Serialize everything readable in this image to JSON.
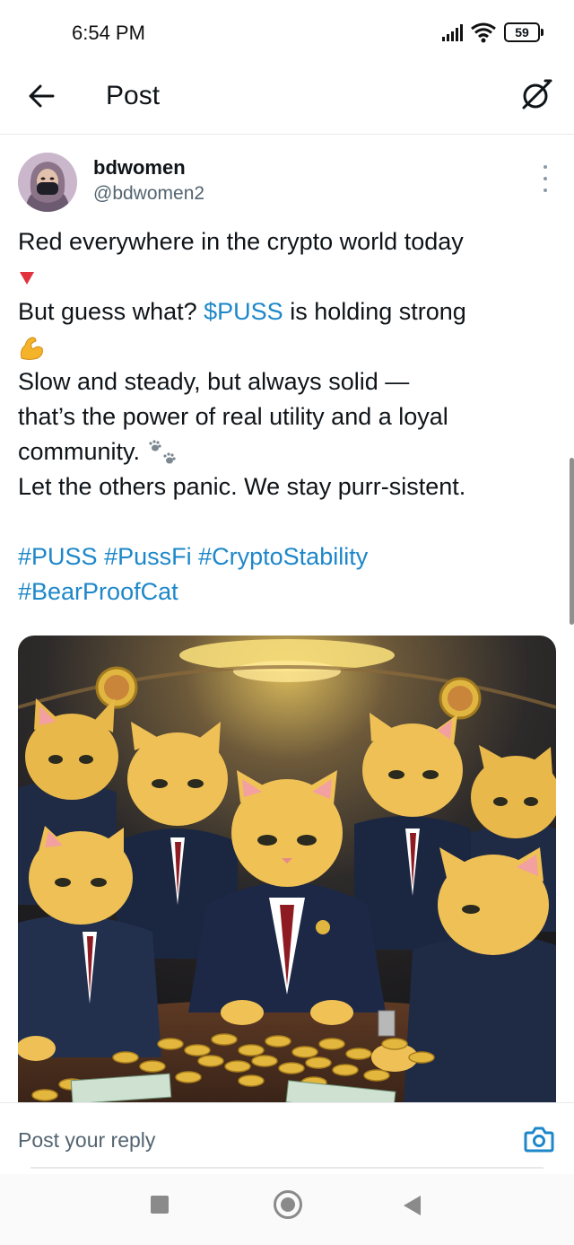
{
  "status_bar": {
    "time": "6:54 PM",
    "battery_level": "59",
    "icons": [
      "signal-icon",
      "wifi-icon",
      "battery-icon"
    ]
  },
  "header": {
    "title": "Post",
    "back_icon": "arrow-left-icon",
    "right_icon": "grok-icon"
  },
  "post": {
    "author": {
      "name": "bdwomen",
      "handle": "@bdwomen2"
    },
    "text": {
      "line1": "Red everywhere in the crypto world today",
      "line2_pre": "But guess what? ",
      "line2_cashtag": "$PUSS",
      "line2_post": " is holding strong",
      "line3": "Slow and steady, but always solid —",
      "line4": "that’s the power of real utility and a loyal",
      "line5": "community. ",
      "line6": "Let the others panic. We stay purr-sistent."
    },
    "hashtags": {
      "line1": [
        "#PUSS",
        "#PussFi",
        "#CryptoStability"
      ],
      "line2": [
        "#BearProofCat"
      ]
    },
    "emojis": [
      "red-triangle-down",
      "flexed-biceps",
      "paw-prints"
    ]
  },
  "reply_bar": {
    "placeholder": "Post your reply",
    "camera_icon": "camera-icon"
  },
  "nav_bar": {
    "icons": [
      "recents-square-icon",
      "home-circle-icon",
      "back-triangle-icon"
    ]
  },
  "colors": {
    "link": "#1d87c9",
    "text": "#0f1419",
    "secondary": "#536471"
  }
}
